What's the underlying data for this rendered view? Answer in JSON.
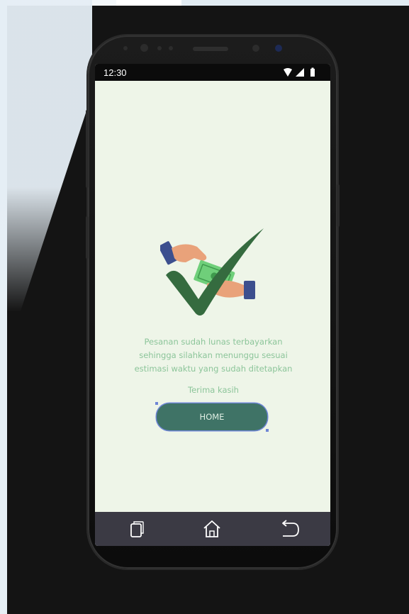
{
  "status_bar": {
    "time": "12:30",
    "icons": [
      "wifi-icon",
      "signal-icon",
      "battery-icon"
    ]
  },
  "illustration": {
    "icon": "payment-success-icon",
    "colors": {
      "check": "#356b3f",
      "cash": "#6fcf7a",
      "sleeve": "#3c4f8e",
      "skin": "#e9a27a"
    }
  },
  "message": {
    "lines": [
      "Pesanan sudah lunas terbayarkan",
      "sehingga silahkan menunggu sesuai",
      "estimasi waktu yang sudah ditetapkan"
    ],
    "thanks": "Terima kasih"
  },
  "home_button": {
    "label": "HOME",
    "color": "#3f7366"
  },
  "nav_bar": {
    "items": [
      "recent-apps-icon",
      "home-icon",
      "back-icon"
    ]
  },
  "theme": {
    "screen_background": "#eef5e8",
    "text_color": "#8cc59a"
  }
}
